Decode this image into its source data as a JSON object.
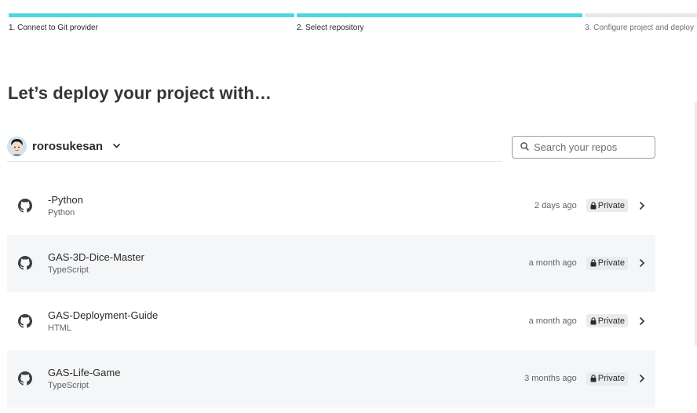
{
  "colors": {
    "progress_done": "#4dd7df",
    "progress_todo": "#e6e8ea"
  },
  "stepper": {
    "steps": [
      {
        "label": "1. Connect to Git provider",
        "status": "done"
      },
      {
        "label": "2. Select repository",
        "status": "done"
      },
      {
        "label": "3. Configure project and deploy",
        "status": "pending"
      }
    ]
  },
  "heading": "Let’s deploy your project with…",
  "account": {
    "name": "rorosukesan",
    "avatar_icon": "avatar-icon",
    "dropdown_icon": "chevron-down-icon"
  },
  "search": {
    "placeholder": "Search your repos",
    "value": ""
  },
  "repos": [
    {
      "name": "-Python",
      "language": "Python",
      "updated": "2 days ago",
      "visibility": "Private"
    },
    {
      "name": "GAS-3D-Dice-Master",
      "language": "TypeScript",
      "updated": "a month ago",
      "visibility": "Private"
    },
    {
      "name": "GAS-Deployment-Guide",
      "language": "HTML",
      "updated": "a month ago",
      "visibility": "Private"
    },
    {
      "name": "GAS-Life-Game",
      "language": "TypeScript",
      "updated": "3 months ago",
      "visibility": "Private"
    }
  ]
}
